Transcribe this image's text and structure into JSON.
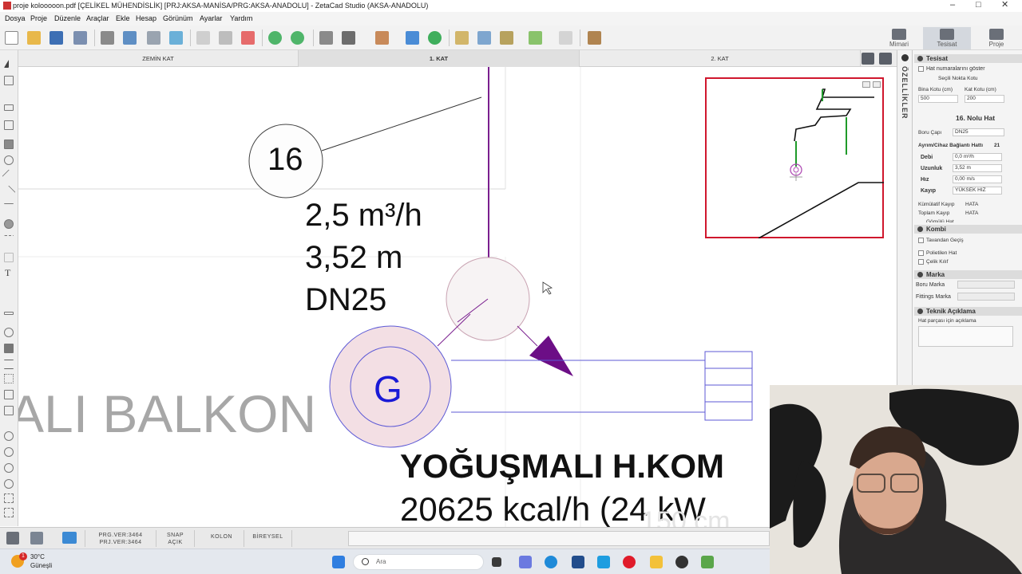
{
  "window": {
    "title": "proje kolooooon.pdf  [ÇELİKEL MÜHENDİSLİK]  [PRJ:AKSA-MANİSA/PRG:AKSA-ANADOLU]  - ZetaCad Studio (AKSA-ANADOLU)",
    "minimize": "–",
    "maximize": "□",
    "close": "✕"
  },
  "menu": [
    "Dosya",
    "Proje",
    "Düzenle",
    "Araçlar",
    "Ekle",
    "Hesap",
    "Görünüm",
    "Ayarlar",
    "Yardım"
  ],
  "modes": {
    "mimari": "Mimari",
    "tesisat": "Tesisat",
    "proje": "Proje"
  },
  "tabs": [
    "ZEMİN KAT",
    "1. KAT",
    "2. KAT"
  ],
  "active_tab": "1. KAT",
  "drawing": {
    "line_no": "16",
    "flow": "2,5 m³/h",
    "length": "3,52 m",
    "diameter": "DN25",
    "meter_symbol": "G",
    "room_label": "ALI BALKON",
    "boiler_title": "YOĞUŞMALI H.KOM",
    "boiler_capacity": "20625 kcal/h (24 kW",
    "faded_dim": "150 cm"
  },
  "side_panel": {
    "vertical_title": "ÖZELLİKLER",
    "tesisat_header": "Tesisat",
    "show_line_numbers": "Hat numaralarını göster",
    "selected_point": "Seçili Nokta Kotu",
    "bina_kotu_label": "Bina Kotu (cm)",
    "kat_kotu_label": "Kat Kotu (cm)",
    "bina_kotu": "500",
    "kat_kotu": "200",
    "line_title": "16. Nolu Hat",
    "boru_capi_label": "Boru Çapı",
    "boru_capi": "DN25",
    "connection_label": "Ayrım/Cihaz Bağlantı Hattı",
    "connection_value": "21",
    "rows": [
      {
        "label": "Debi",
        "value": "0,0 m³/h"
      },
      {
        "label": "Uzunluk",
        "value": "3,52 m"
      },
      {
        "label": "Hız",
        "value": "0,00 m/s"
      },
      {
        "label": "Kayıp",
        "value": "YÜKSEK HIZ"
      }
    ],
    "kumulatif_label": "Kümülatif Kayıp",
    "kumulatif_value": "HATA",
    "toplam_label": "Toplam Kayıp",
    "toplam_value": "HATA",
    "cut_row": "Gömülü Hat",
    "kombi_header": "Kombi",
    "tavandan": "Tavandan Geçiş",
    "polietilen": "Polietilen Hat",
    "celik": "Çelik Kılıf",
    "marka_header": "Marka",
    "boru_marka": "Boru Marka",
    "fittings_marka": "Fittings Marka",
    "teknik_header": "Teknik Açıklama",
    "teknik_hint": "Hat parçası için açıklama"
  },
  "status": {
    "prg_ver": "PRG.VER:3464",
    "prj_ver": "PRJ.VER:3464",
    "snap": "SNAP",
    "snap_state": "AÇIK",
    "kolon": "KOLON",
    "bireysel": "BİREYSEL"
  },
  "taskbar": {
    "weather_temp": "30°C",
    "weather_desc": "Güneşli",
    "weather_badge": "1",
    "search_placeholder": "Ara"
  },
  "colors": {
    "pipe_purple": "#7a1f8f",
    "meter_fill": "#f3dfe4",
    "meter_text": "#1a1ad6",
    "arrow": "#6c0e86",
    "preview_border": "#d0172d",
    "green_pipe": "#1f9a2a"
  }
}
